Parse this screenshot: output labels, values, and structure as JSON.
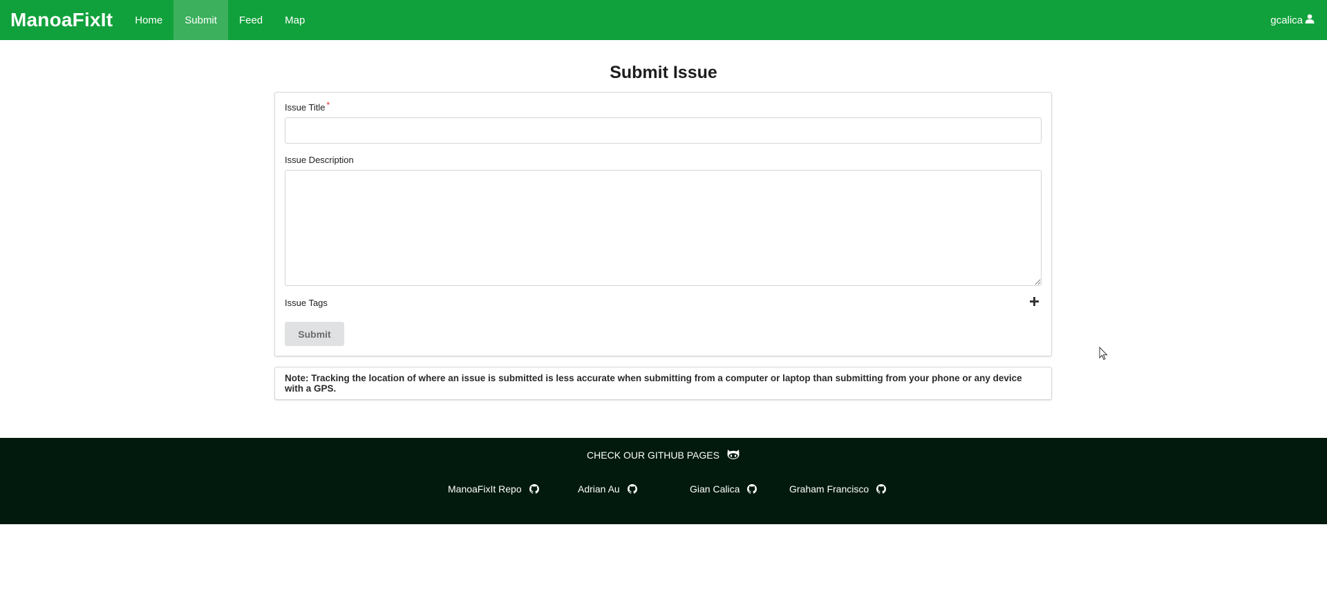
{
  "navbar": {
    "brand": "ManoaFixIt",
    "items": [
      {
        "label": "Home",
        "active": false
      },
      {
        "label": "Submit",
        "active": true
      },
      {
        "label": "Feed",
        "active": false
      },
      {
        "label": "Map",
        "active": false
      }
    ],
    "user": "gcalica",
    "user_icon": "user-icon",
    "background_color": "#11a13c",
    "active_color": "#3cb05d"
  },
  "page": {
    "title": "Submit Issue"
  },
  "form": {
    "title_label": "Issue Title",
    "required_marker": "*",
    "title_value": "",
    "description_label": "Issue Description",
    "description_value": "",
    "tags_label": "Issue Tags",
    "add_tag_icon": "plus-icon",
    "submit_label": "Submit"
  },
  "note": {
    "text": "Note: Tracking the location of where an issue is submitted is less accurate when submitting from a computer or laptop than submitting from your phone or any device with a GPS."
  },
  "footer": {
    "title": "CHECK OUR GITHUB PAGES",
    "title_icon": "octocat-icon",
    "links": [
      {
        "label": "ManoaFixIt Repo",
        "icon": "github-icon"
      },
      {
        "label": "Adrian Au",
        "icon": "github-icon"
      },
      {
        "label": "Gian Calica",
        "icon": "github-icon"
      },
      {
        "label": "Graham Francisco",
        "icon": "github-icon"
      }
    ],
    "background_color": "#021a0d"
  }
}
